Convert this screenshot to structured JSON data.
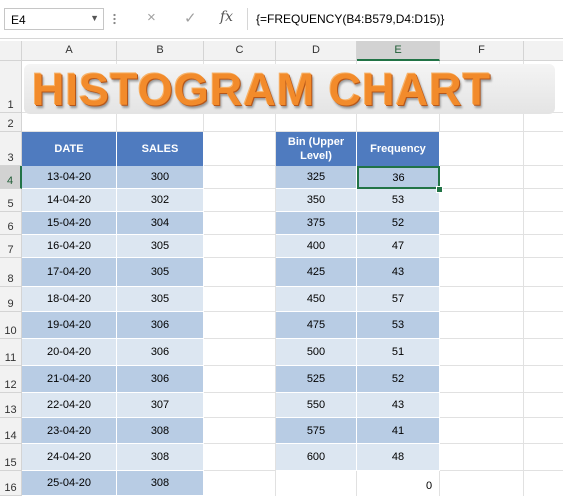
{
  "name_box": "E4",
  "formula_icons": {
    "cancel": "×",
    "enter": "✓",
    "fx": "fx"
  },
  "formula": "{=FREQUENCY(B4:B579,D4:D15)}",
  "columns": [
    "A",
    "B",
    "C",
    "D",
    "E",
    "F"
  ],
  "rows": [
    "1",
    "2",
    "3",
    "4",
    "5",
    "6",
    "7",
    "8",
    "9",
    "10",
    "11",
    "12",
    "13",
    "14",
    "15",
    "16"
  ],
  "title": "HISTOGRAM CHART",
  "sales_table": {
    "headers": [
      "DATE",
      "SALES"
    ],
    "rows": [
      [
        "13-04-20",
        "300"
      ],
      [
        "14-04-20",
        "302"
      ],
      [
        "15-04-20",
        "304"
      ],
      [
        "16-04-20",
        "305"
      ],
      [
        "17-04-20",
        "305"
      ],
      [
        "18-04-20",
        "305"
      ],
      [
        "19-04-20",
        "306"
      ],
      [
        "20-04-20",
        "306"
      ],
      [
        "21-04-20",
        "306"
      ],
      [
        "22-04-20",
        "307"
      ],
      [
        "23-04-20",
        "308"
      ],
      [
        "24-04-20",
        "308"
      ],
      [
        "25-04-20",
        "308"
      ]
    ]
  },
  "bin_table": {
    "headers": [
      "Bin (Upper Level)",
      "Frequency"
    ],
    "rows": [
      [
        "325",
        "36"
      ],
      [
        "350",
        "53"
      ],
      [
        "375",
        "52"
      ],
      [
        "400",
        "47"
      ],
      [
        "425",
        "43"
      ],
      [
        "450",
        "57"
      ],
      [
        "475",
        "53"
      ],
      [
        "500",
        "51"
      ],
      [
        "525",
        "52"
      ],
      [
        "550",
        "43"
      ],
      [
        "575",
        "41"
      ],
      [
        "600",
        "48"
      ]
    ]
  },
  "overflow_value": "0",
  "colors": {
    "header_blue": "#4f7bbf",
    "band_dark": "#b8cce4",
    "band_light": "#dce6f1",
    "select_green": "#217346",
    "title_orange": "#f28b2b"
  }
}
